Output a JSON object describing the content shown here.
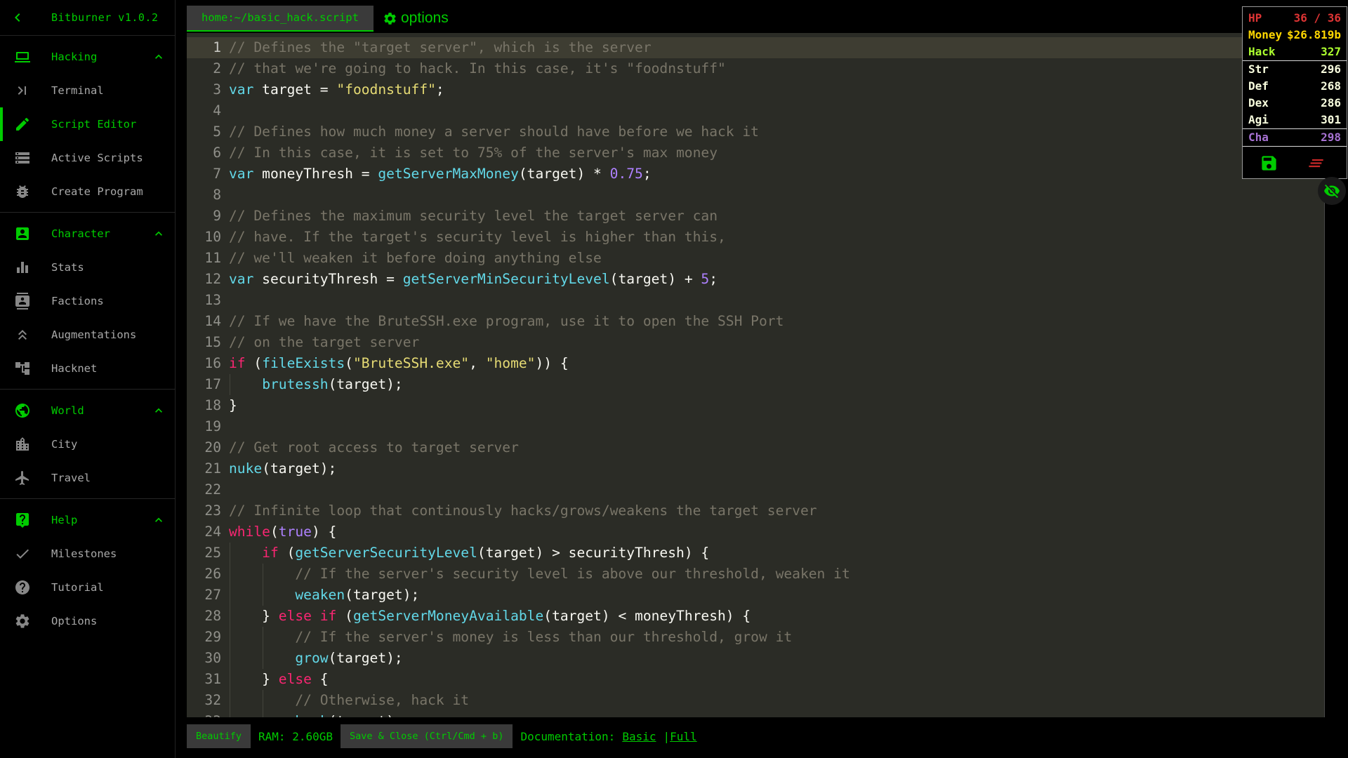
{
  "app": {
    "title": "Bitburner v1.0.2"
  },
  "colors": {
    "accent_green": "#00cc00",
    "hp": "#dd3434",
    "money": "#ffd700",
    "hack": "#adff2f",
    "combat": "#faffdf",
    "charisma": "#a671d1",
    "editor_bg": "#2b2c26",
    "editor_line_highlight": "#3e3d32",
    "token_comment": "#797568",
    "token_keyword": "#f92672",
    "token_function": "#62d8e8",
    "token_string": "#e6db74",
    "token_number": "#ae81ff",
    "token_plain": "#f8f8f2"
  },
  "sidebar": {
    "back_icon": "chevron-left-icon",
    "sections": [
      {
        "id": "hacking",
        "label": "Hacking",
        "icon": "laptop-icon",
        "chevron": "chevron-up-icon",
        "items": [
          {
            "id": "terminal",
            "label": "Terminal",
            "icon": "terminal-icon"
          },
          {
            "id": "script-editor",
            "label": "Script Editor",
            "icon": "pencil-icon",
            "selected": true
          },
          {
            "id": "active-scripts",
            "label": "Active Scripts",
            "icon": "scripts-list-icon"
          },
          {
            "id": "create-program",
            "label": "Create Program",
            "icon": "bug-icon"
          }
        ]
      },
      {
        "id": "character",
        "label": "Character",
        "icon": "person-icon",
        "chevron": "chevron-up-icon",
        "items": [
          {
            "id": "stats",
            "label": "Stats",
            "icon": "stats-bars-icon"
          },
          {
            "id": "factions",
            "label": "Factions",
            "icon": "factions-badge-icon"
          },
          {
            "id": "augmentations",
            "label": "Augmentations",
            "icon": "augmentations-chevrons-icon"
          },
          {
            "id": "hacknet",
            "label": "Hacknet",
            "icon": "hacknet-nodes-icon"
          }
        ]
      },
      {
        "id": "world",
        "label": "World",
        "icon": "globe-icon",
        "chevron": "chevron-up-icon",
        "items": [
          {
            "id": "city",
            "label": "City",
            "icon": "city-icon"
          },
          {
            "id": "travel",
            "label": "Travel",
            "icon": "airplane-icon"
          }
        ]
      },
      {
        "id": "help",
        "label": "Help",
        "icon": "help-bubble-icon",
        "chevron": "chevron-up-icon",
        "items": [
          {
            "id": "milestones",
            "label": "Milestones",
            "icon": "check-icon"
          },
          {
            "id": "tutorial",
            "label": "Tutorial",
            "icon": "question-circle-icon"
          },
          {
            "id": "options",
            "label": "Options",
            "icon": "gear-icon"
          }
        ]
      }
    ]
  },
  "editor": {
    "tab": "home:~/basic_hack.script",
    "options_icon": "gear-icon",
    "options_label": "options",
    "lines": [
      {
        "hl": true,
        "seg": [
          [
            "c",
            "// Defines the \"target server\", which is the server"
          ]
        ]
      },
      {
        "seg": [
          [
            "c",
            "// that we're going to hack. In this case, it's \"foodnstuff\""
          ]
        ]
      },
      {
        "seg": [
          [
            "f",
            "var"
          ],
          [
            "p",
            " target = "
          ],
          [
            "s",
            "\"foodnstuff\""
          ],
          [
            "p",
            ";"
          ]
        ]
      },
      {
        "seg": []
      },
      {
        "seg": [
          [
            "c",
            "// Defines how much money a server should have before we hack it"
          ]
        ]
      },
      {
        "seg": [
          [
            "c",
            "// In this case, it is set to 75% of the server's max money"
          ]
        ]
      },
      {
        "seg": [
          [
            "f",
            "var"
          ],
          [
            "p",
            " moneyThresh = "
          ],
          [
            "f",
            "getServerMaxMoney"
          ],
          [
            "p",
            "(target) * "
          ],
          [
            "n",
            "0.75"
          ],
          [
            "p",
            ";"
          ]
        ]
      },
      {
        "seg": []
      },
      {
        "seg": [
          [
            "c",
            "// Defines the maximum security level the target server can"
          ]
        ]
      },
      {
        "seg": [
          [
            "c",
            "// have. If the target's security level is higher than this,"
          ]
        ]
      },
      {
        "seg": [
          [
            "c",
            "// we'll weaken it before doing anything else"
          ]
        ]
      },
      {
        "seg": [
          [
            "f",
            "var"
          ],
          [
            "p",
            " securityThresh = "
          ],
          [
            "f",
            "getServerMinSecurityLevel"
          ],
          [
            "p",
            "(target) + "
          ],
          [
            "n",
            "5"
          ],
          [
            "p",
            ";"
          ]
        ]
      },
      {
        "seg": []
      },
      {
        "seg": [
          [
            "c",
            "// If we have the BruteSSH.exe program, use it to open the SSH Port"
          ]
        ]
      },
      {
        "seg": [
          [
            "c",
            "// on the target server"
          ]
        ]
      },
      {
        "seg": [
          [
            "k",
            "if"
          ],
          [
            "p",
            " ("
          ],
          [
            "f",
            "fileExists"
          ],
          [
            "p",
            "("
          ],
          [
            "s",
            "\"BruteSSH.exe\""
          ],
          [
            "p",
            ", "
          ],
          [
            "s",
            "\"home\""
          ],
          [
            "p",
            ")) {"
          ]
        ]
      },
      {
        "g": 1,
        "seg": [
          [
            "p",
            "    "
          ],
          [
            "f",
            "brutessh"
          ],
          [
            "p",
            "(target);"
          ]
        ]
      },
      {
        "seg": [
          [
            "p",
            "}"
          ]
        ]
      },
      {
        "seg": []
      },
      {
        "seg": [
          [
            "c",
            "// Get root access to target server"
          ]
        ]
      },
      {
        "seg": [
          [
            "f",
            "nuke"
          ],
          [
            "p",
            "(target);"
          ]
        ]
      },
      {
        "seg": []
      },
      {
        "seg": [
          [
            "c",
            "// Infinite loop that continously hacks/grows/weakens the target server"
          ]
        ]
      },
      {
        "seg": [
          [
            "k",
            "while"
          ],
          [
            "p",
            "("
          ],
          [
            "n",
            "true"
          ],
          [
            "p",
            ") {"
          ]
        ]
      },
      {
        "g": 1,
        "seg": [
          [
            "p",
            "    "
          ],
          [
            "k",
            "if"
          ],
          [
            "p",
            " ("
          ],
          [
            "f",
            "getServerSecurityLevel"
          ],
          [
            "p",
            "(target) > securityThresh) {"
          ]
        ]
      },
      {
        "g": 2,
        "seg": [
          [
            "p",
            "        "
          ],
          [
            "c",
            "// If the server's security level is above our threshold, weaken it"
          ]
        ]
      },
      {
        "g": 2,
        "seg": [
          [
            "p",
            "        "
          ],
          [
            "f",
            "weaken"
          ],
          [
            "p",
            "(target);"
          ]
        ]
      },
      {
        "g": 1,
        "seg": [
          [
            "p",
            "    } "
          ],
          [
            "k",
            "else"
          ],
          [
            "p",
            " "
          ],
          [
            "k",
            "if"
          ],
          [
            "p",
            " ("
          ],
          [
            "f",
            "getServerMoneyAvailable"
          ],
          [
            "p",
            "(target) < moneyThresh) {"
          ]
        ]
      },
      {
        "g": 2,
        "seg": [
          [
            "p",
            "        "
          ],
          [
            "c",
            "// If the server's money is less than our threshold, grow it"
          ]
        ]
      },
      {
        "g": 2,
        "seg": [
          [
            "p",
            "        "
          ],
          [
            "f",
            "grow"
          ],
          [
            "p",
            "(target);"
          ]
        ]
      },
      {
        "g": 1,
        "seg": [
          [
            "p",
            "    } "
          ],
          [
            "k",
            "else"
          ],
          [
            "p",
            " {"
          ]
        ]
      },
      {
        "g": 2,
        "seg": [
          [
            "p",
            "        "
          ],
          [
            "c",
            "// Otherwise, hack it"
          ]
        ]
      },
      {
        "g": 2,
        "seg": [
          [
            "p",
            "        "
          ],
          [
            "f",
            "hack"
          ],
          [
            "p",
            "(target);"
          ]
        ]
      }
    ]
  },
  "footer": {
    "beautify": "Beautify",
    "ram": "RAM: 2.60GB",
    "save_close": "Save & Close (Ctrl/Cmd + b)",
    "documentation_label": "Documentation:",
    "doc_basic": "Basic",
    "doc_pipe": "|",
    "doc_full": "Full"
  },
  "stats_overlay": {
    "rows": [
      {
        "id": "hp",
        "label": "HP",
        "value": "36 / 36",
        "type": "hp"
      },
      {
        "id": "money",
        "label": "Money",
        "value": "$26.819b",
        "type": "money"
      },
      {
        "id": "hack",
        "label": "Hack",
        "value": "327",
        "type": "hack",
        "sep": true
      },
      {
        "id": "str",
        "label": "Str",
        "value": "296",
        "type": "combat"
      },
      {
        "id": "def",
        "label": "Def",
        "value": "268",
        "type": "combat"
      },
      {
        "id": "dex",
        "label": "Dex",
        "value": "286",
        "type": "combat"
      },
      {
        "id": "agi",
        "label": "Agi",
        "value": "301",
        "type": "combat",
        "sep": true
      },
      {
        "id": "cha",
        "label": "Cha",
        "value": "298",
        "type": "cha",
        "sep": true
      }
    ],
    "save_icon": "save-icon",
    "kill_scripts_icon": "clear-scripts-icon"
  },
  "overlay_toggle_icon": "eye-off-icon"
}
